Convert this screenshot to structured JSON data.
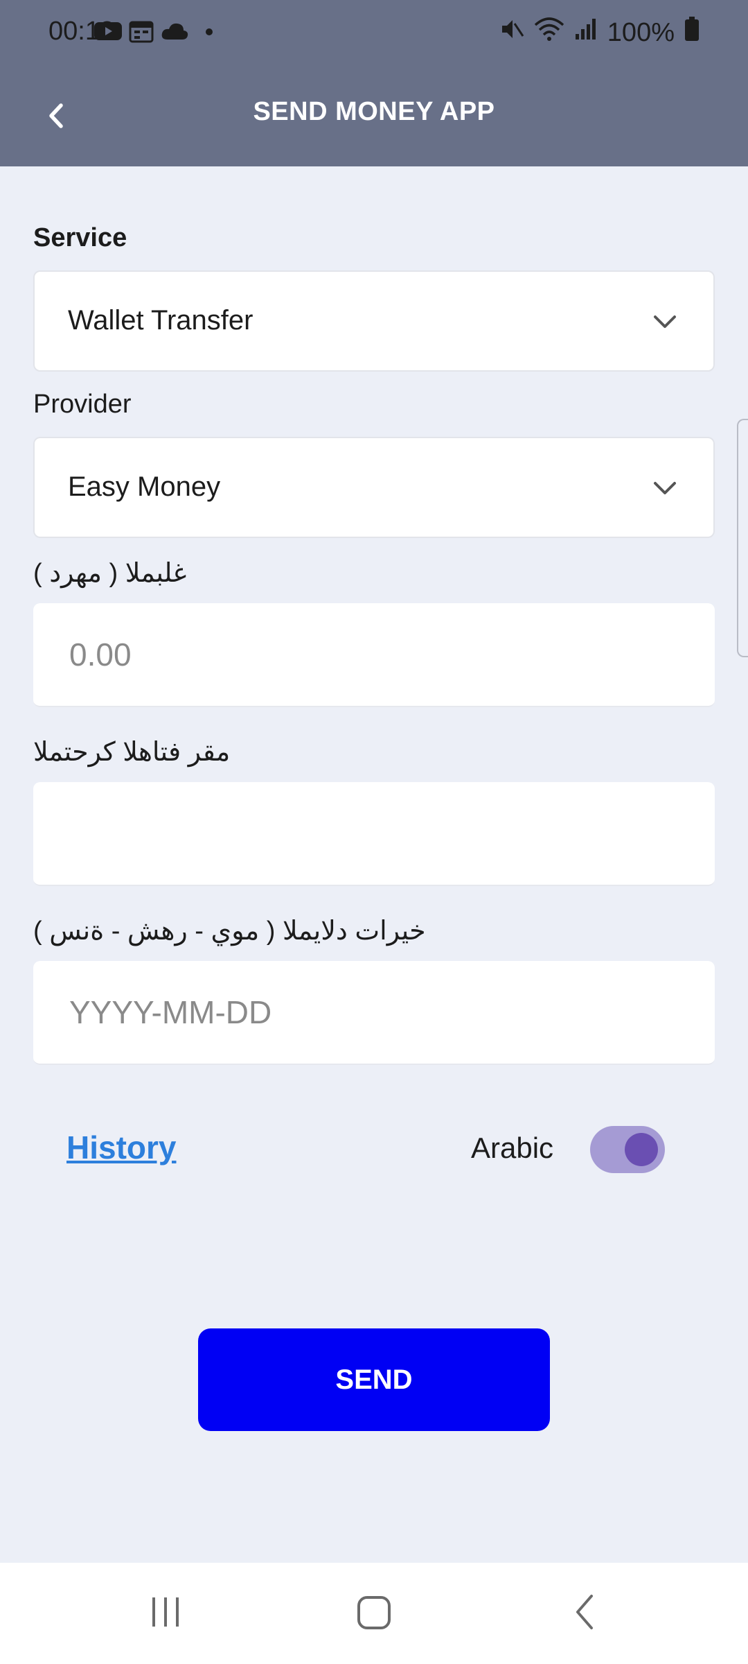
{
  "status_bar": {
    "time": "00:18",
    "battery": "100%",
    "left_icons": [
      "youtube-icon",
      "calendar-icon",
      "cloud-icon",
      "dot-icon"
    ],
    "right_icons": [
      "mute-icon",
      "wifi-icon",
      "signal-icon",
      "battery-icon"
    ]
  },
  "app_bar": {
    "title": "SEND MONEY APP",
    "back_icon": "back-arrow-icon",
    "background": "#687088"
  },
  "form": {
    "service": {
      "label": "Service",
      "value": "Wallet Transfer"
    },
    "provider": {
      "label": "Provider",
      "value": "Easy Money"
    },
    "amount": {
      "label": "غلبملا ( مهرد )",
      "placeholder": "0.00",
      "value": ""
    },
    "reference": {
      "label": "مقر فتاهلا كرحتملا",
      "placeholder": "",
      "value": ""
    },
    "birth_date": {
      "label": "خيرات دلايملا ( موي - رهش - ةنس )",
      "placeholder": "YYYY-MM-DD",
      "value": ""
    }
  },
  "footer_controls": {
    "history_label": "History",
    "language_label": "Arabic",
    "language_toggle_on": true,
    "history_color": "#2d7fdc",
    "toggle_track_color": "#a59bd4",
    "toggle_knob_color": "#6a4fb2"
  },
  "send_button": {
    "label": "SEND",
    "color": "#0000f4"
  },
  "nav_bar": {
    "icons": [
      "recent-apps-icon",
      "home-icon",
      "back-icon"
    ]
  }
}
